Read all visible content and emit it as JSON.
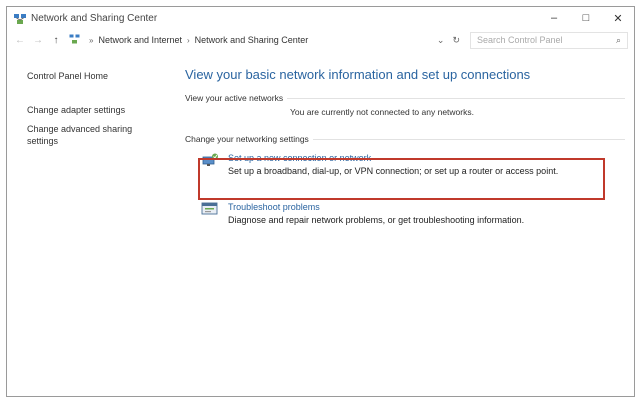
{
  "window": {
    "title": "Network and Sharing Center",
    "controls": {
      "minimize": "–",
      "maximize": "□",
      "close": "✕"
    }
  },
  "address_bar": {
    "back": "←",
    "forward": "→",
    "up": "↑",
    "breadcrumbs": [
      "Network and Internet",
      "Network and Sharing Center"
    ],
    "dropdown": "⌄",
    "refresh": "↻",
    "search_placeholder": "Search Control Panel",
    "search_icon": "⌕"
  },
  "sidebar": {
    "home": "Control Panel Home",
    "links": [
      "Change adapter settings",
      "Change advanced sharing",
      "settings"
    ]
  },
  "main": {
    "heading": "View your basic network information and set up connections",
    "active_networks_label": "View your active networks",
    "active_networks_status": "You are currently not connected to any networks.",
    "settings_label": "Change your networking settings",
    "tasks": [
      {
        "title": "Set up a new connection or network",
        "desc": "Set up a broadband, dial-up, or VPN connection; or set up a router or access point.",
        "icon": "network-setup-icon"
      },
      {
        "title": "Troubleshoot problems",
        "desc": "Diagnose and repair network problems, or get troubleshooting information.",
        "icon": "troubleshoot-icon"
      }
    ]
  },
  "highlight_color": "#c0392b",
  "link_color": "#2a64a0"
}
